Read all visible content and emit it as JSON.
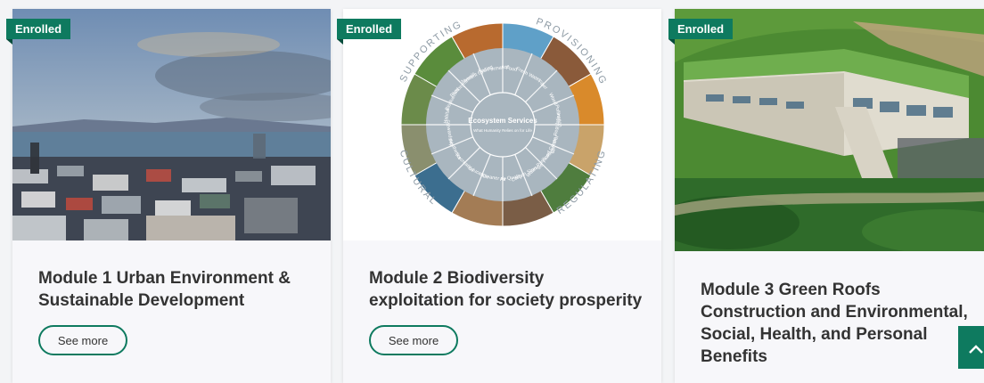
{
  "cards": [
    {
      "badge": "Enrolled",
      "title": "Module 1 Urban Environment & Sustainable Development",
      "button": "See more"
    },
    {
      "badge": "Enrolled",
      "title": "Module 2 Biodiversity exploitation for society prosperity",
      "button": "See more"
    },
    {
      "badge": "Enrolled",
      "title": "Module 3 Green Roofs Construction and Environmental, Social, Health, and Personal Benefits"
    }
  ],
  "diagram": {
    "center_title": "Ecosystem Services",
    "center_subtitle": "What Humanity Relies on for Life",
    "quadrants": [
      "SUPPORTING",
      "PROVISIONING",
      "REGULATING",
      "CULTURAL"
    ],
    "segments": [
      "Food",
      "Fresh Water",
      "Fiber",
      "Wood",
      "Pollination",
      "Climate Regulation",
      "Flood Control",
      "Water Purification",
      "Carbon Storage",
      "Air Quality",
      "Cleaner Air",
      "Education",
      "Recreation",
      "Aesthetics",
      "Stewardship",
      "Habitat",
      "Biodiversity",
      "Photosynthesis",
      "Nutrient Cycling",
      "Soil Formation"
    ]
  },
  "colors": {
    "accent": "#0e7a5f",
    "title": "#333333",
    "card_bg": "#f7f7fa"
  },
  "icons": {
    "scroll_top": "chevron-up-icon"
  }
}
